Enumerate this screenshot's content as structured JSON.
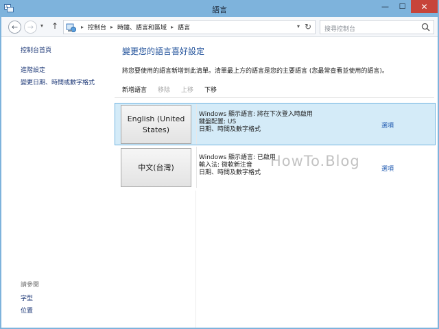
{
  "window": {
    "title": "語言",
    "controls": {
      "minimize": "—",
      "maximize": "☐",
      "close": "✕"
    }
  },
  "nav": {
    "back": "←",
    "forward": "→",
    "recent": "▾",
    "up": "↑",
    "breadcrumb": [
      "控制台",
      "時鐘、語言和區域",
      "語言"
    ],
    "breadcrumb_sep": "▸",
    "address_dropdown": "▾",
    "refresh": "↻",
    "search_placeholder": "搜尋控制台"
  },
  "sidebar": {
    "links": [
      "控制台首頁",
      "進階設定",
      "變更日期、時間或數字格式"
    ],
    "see_also_title": "請參閱",
    "see_also_links": [
      "字型",
      "位置"
    ]
  },
  "main": {
    "heading": "變更您的語言喜好設定",
    "description": "將您要使用的語言新增到此清單。清單最上方的語言是您的主要語言 (您最常查看並使用的語言)。",
    "toolbar": {
      "add": "新增語言",
      "remove": "移除",
      "move_up": "上移",
      "move_down": "下移"
    },
    "languages": [
      {
        "name": "English (United States)",
        "details": [
          "Windows 顯示語言: 將在下次登入時啟用",
          "鍵盤配置: US",
          "日期、時間及數字格式"
        ],
        "option": "選項",
        "selected": true
      },
      {
        "name": "中文(台灣)",
        "details": [
          "Windows 顯示語言: 已啟用",
          "輸入法: 微軟新注音",
          "日期、時間及數字格式"
        ],
        "option": "選項",
        "selected": false
      }
    ]
  },
  "watermark": "HowTo.Blog",
  "colors": {
    "titlebar": "#7eb3dc",
    "close_button": "#c7443a",
    "link": "#1f3a78",
    "heading": "#1e4f99",
    "selected_row": "#d4ebf8",
    "selected_border": "#6fb3e0"
  }
}
